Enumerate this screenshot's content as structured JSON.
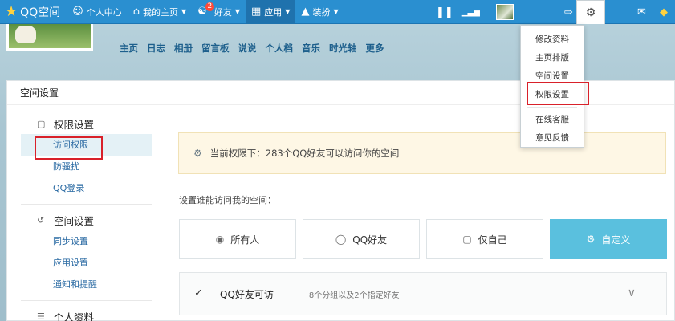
{
  "topbar": {
    "logo": "QQ空间",
    "nav": [
      {
        "label": "个人中心",
        "icon": "person-icon"
      },
      {
        "label": "我的主页",
        "icon": "home-icon",
        "caret": true
      },
      {
        "label": "好友",
        "icon": "friends-icon",
        "caret": true,
        "badge": "2"
      },
      {
        "label": "应用",
        "icon": "grid-icon",
        "caret": true
      },
      {
        "label": "装扮",
        "icon": "shirt-icon",
        "caret": true
      }
    ]
  },
  "subnav": [
    "主页",
    "日志",
    "相册",
    "留言板",
    "说说",
    "个人档",
    "音乐",
    "时光轴",
    "更多"
  ],
  "panel": {
    "title": "空间设置"
  },
  "sidebar": {
    "sections": [
      {
        "title": "权限设置",
        "items": [
          "访问权限",
          "防骚扰",
          "QQ登录"
        ]
      },
      {
        "title": "空间设置",
        "items": [
          "同步设置",
          "应用设置",
          "通知和提醒"
        ]
      },
      {
        "title": "个人资料",
        "items": []
      }
    ]
  },
  "notice": "当前权限下：283个QQ好友可以访问你的空间",
  "who_label": "设置谁能访问我的空间：",
  "options": [
    {
      "label": "所有人",
      "icon": "globe-icon"
    },
    {
      "label": "QQ好友",
      "icon": "qq-penguin-icon"
    },
    {
      "label": "仅自己",
      "icon": "lock-icon"
    },
    {
      "label": "自定义",
      "icon": "gear-icon"
    }
  ],
  "selected_option": "自定义",
  "rule": {
    "title": "QQ好友可访",
    "desc": "8个分组以及2个指定好友",
    "checked": true
  },
  "dropdown": [
    "修改资料",
    "主页排版",
    "空间设置",
    "权限设置",
    "在线客服",
    "意见反馈"
  ],
  "colors": {
    "topbar": "#2a8fd0",
    "highlight": "#d9212a",
    "active_option": "#5ac0de"
  }
}
